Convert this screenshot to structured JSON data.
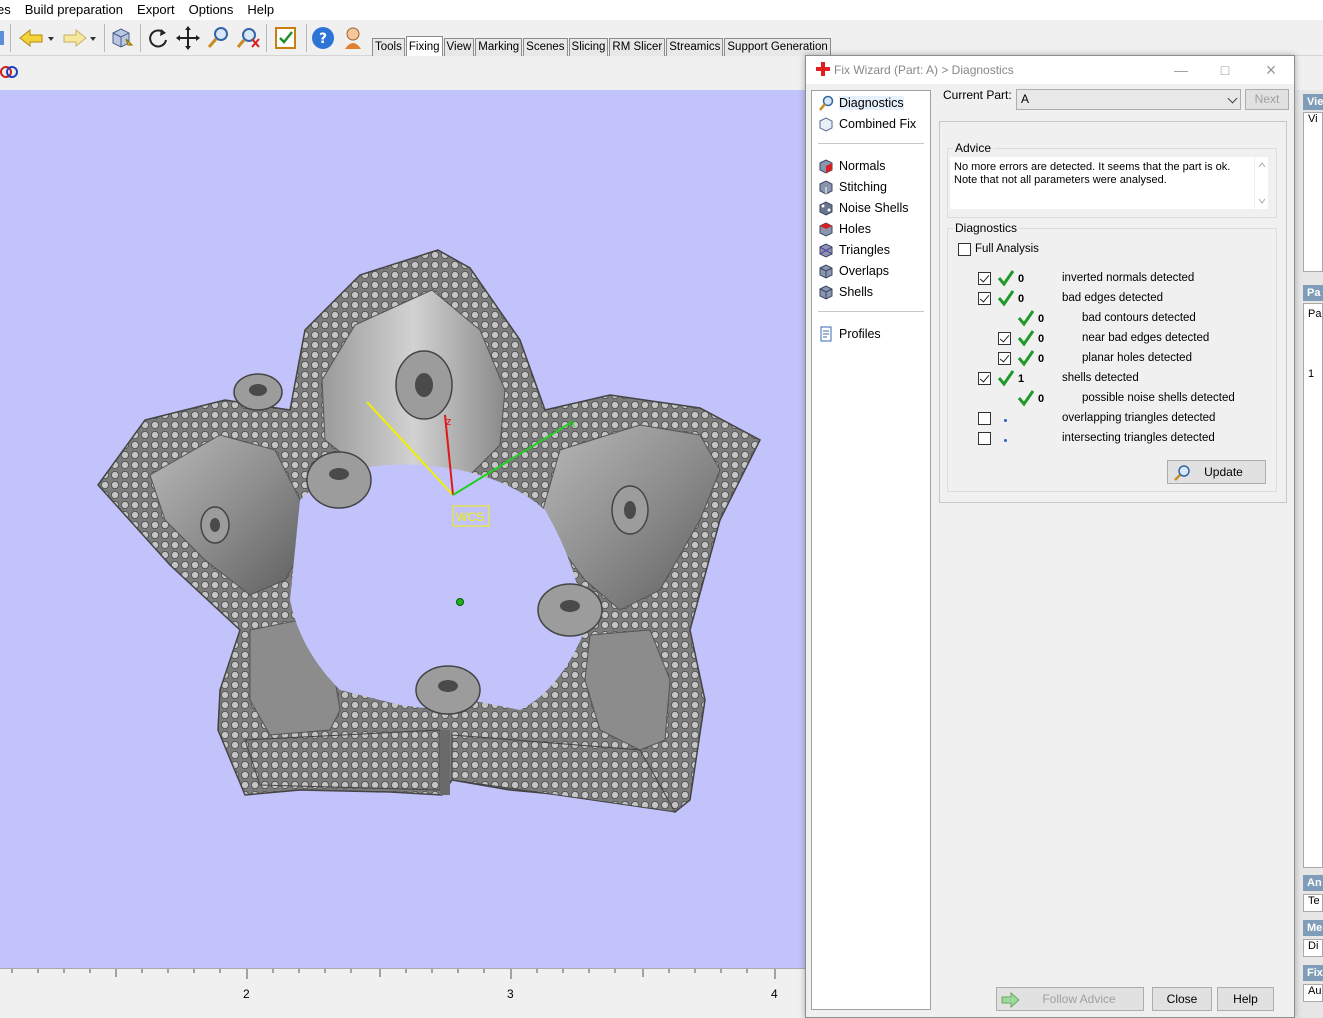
{
  "menu": [
    "es",
    "Build preparation",
    "Export",
    "Options",
    "Help"
  ],
  "tabs": [
    "Tools",
    "Fixing",
    "View",
    "Marking",
    "Scenes",
    "Slicing",
    "RM Slicer",
    "Streamics",
    "Support Generation"
  ],
  "active_tab": "Fixing",
  "viewport": {
    "axis_label": "WCS",
    "axis_z": "z",
    "axis_x": "x",
    "ruler_labels": [
      "2",
      "3",
      "4"
    ]
  },
  "dialog": {
    "title": "Fix Wizard (Part: A) > Diagnostics",
    "nav_top": [
      "Diagnostics",
      "Combined Fix"
    ],
    "nav_mid": [
      "Normals",
      "Stitching",
      "Noise Shells",
      "Holes",
      "Triangles",
      "Overlaps",
      "Shells"
    ],
    "nav_bottom": [
      "Profiles"
    ],
    "current_part_label": "Current Part:",
    "current_part_value": "A",
    "next_label": "Next",
    "advice_title": "Advice",
    "advice_text": "No more errors are detected. It seems that the part is ok. Note that not all parameters were analysed.",
    "diagnostics_title": "Diagnostics",
    "full_analysis_label": "Full Analysis",
    "rows": [
      {
        "count": "0",
        "label": "inverted normals detected"
      },
      {
        "count": "0",
        "label": "bad edges detected"
      },
      {
        "count": "0",
        "label": "bad contours detected"
      },
      {
        "count": "0",
        "label": "near bad edges detected"
      },
      {
        "count": "0",
        "label": "planar holes detected"
      },
      {
        "count": "1",
        "label": "shells detected"
      },
      {
        "count": "0",
        "label": "possible noise shells detected"
      },
      {
        "count": "",
        "label": "overlapping triangles detected"
      },
      {
        "count": "",
        "label": "intersecting triangles detected"
      }
    ],
    "update_label": "Update",
    "follow_advice_label": "Follow Advice",
    "close_label": "Close",
    "help_label": "Help"
  },
  "side_panel": {
    "headers": [
      "Vie",
      "Pa",
      "An",
      "Me",
      "Fix"
    ],
    "boxes": [
      "Vi",
      "Pa",
      "1",
      "Te",
      "Di",
      "Au"
    ]
  }
}
